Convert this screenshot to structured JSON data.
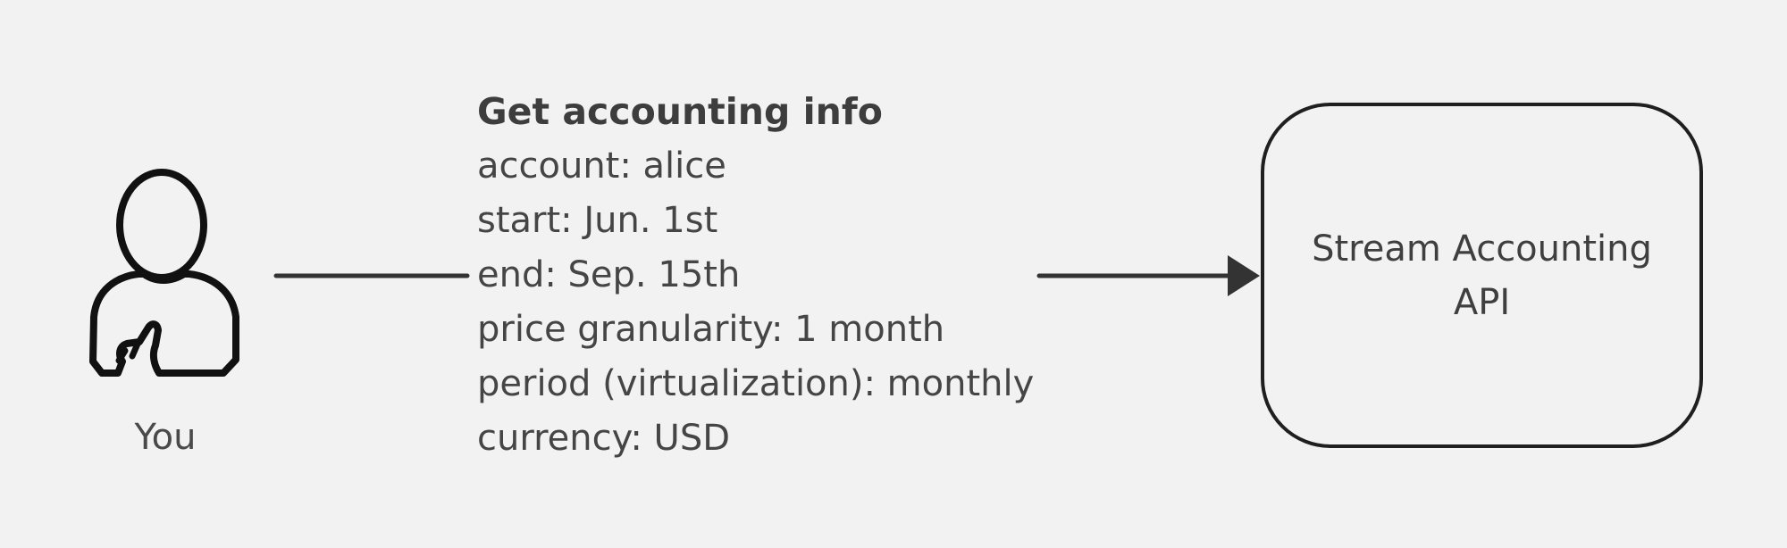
{
  "diagram": {
    "actor": {
      "icon": "person-icon",
      "label": "You"
    },
    "request": {
      "title": "Get accounting info",
      "lines": [
        "account: alice",
        "start: Jun. 1st",
        "end: Sep. 15th",
        "price granularity: 1 month",
        "period (virtualization): monthly",
        "currency: USD"
      ]
    },
    "service": {
      "label": "Stream Accounting API"
    },
    "colors": {
      "background": "#f2f2f2",
      "stroke": "#1f1f1f",
      "text": "#454545"
    }
  }
}
